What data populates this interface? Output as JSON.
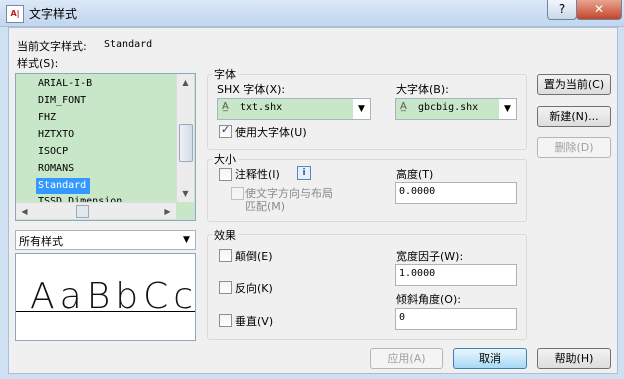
{
  "window": {
    "title": "文字样式",
    "help": "?",
    "close": "✕",
    "app_icon_text": "A|"
  },
  "current_style": {
    "label": "当前文字样式:",
    "value": "Standard"
  },
  "styles": {
    "label": "样式(S):",
    "items": [
      "ARIAL-I-B",
      "DIM_FONT",
      "FHZ",
      "HZTXTO",
      "ISOCP",
      "ROMANS",
      "Standard",
      "TSSD_Dimension"
    ],
    "selected": "Standard"
  },
  "filter": {
    "value": "所有样式"
  },
  "preview": {
    "text": "AaBbCc"
  },
  "font": {
    "group_title": "字体",
    "shx_label": "SHX 字体(X):",
    "shx_value": "txt.shx",
    "big_label": "大字体(B):",
    "big_value": "gbcbig.shx",
    "use_big_label": "使用大字体(U)",
    "use_big_checked": true
  },
  "size": {
    "group_title": "大小",
    "annotative_label": "注释性(I)",
    "info_icon": "i",
    "match_label_1": "使文字方向与布局",
    "match_label_2": "匹配(M)",
    "height_label": "高度(T)",
    "height_value": "0.0000"
  },
  "effects": {
    "group_title": "效果",
    "upside_down": "颠倒(E)",
    "backwards": "反向(K)",
    "vertical": "垂直(V)",
    "width_label": "宽度因子(W):",
    "width_value": "1.0000",
    "oblique_label": "倾斜角度(O):",
    "oblique_value": "0"
  },
  "buttons": {
    "set_current": "置为当前(C)",
    "new": "新建(N)...",
    "delete": "删除(D)",
    "apply": "应用(A)",
    "cancel": "取消",
    "help": "帮助(H)"
  },
  "colors": {
    "list_bg": "#c8e6c8",
    "selection": "#3399ff",
    "dialog_bg": "#f0f0f0"
  }
}
